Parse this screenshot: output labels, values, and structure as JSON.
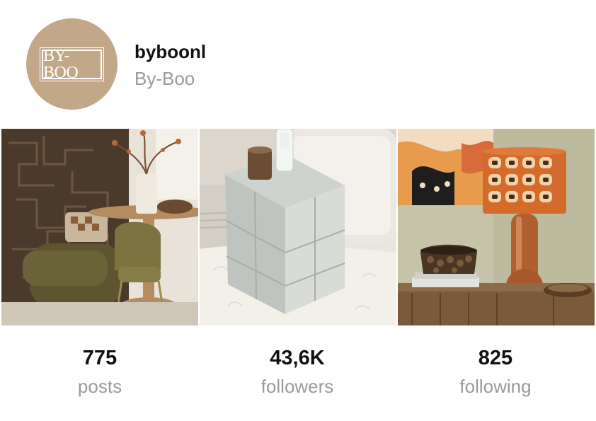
{
  "profile": {
    "username": "byboonl",
    "display_name": "By-Boo",
    "avatar_logo_text": "BY-BOO",
    "avatar_color": "#c3a789"
  },
  "posts_grid": [
    {
      "subject": "dining-nook-photo"
    },
    {
      "subject": "mirrored-side-table-photo"
    },
    {
      "subject": "retro-table-lamp-photo"
    }
  ],
  "stats": {
    "posts": {
      "count": "775",
      "label": "posts"
    },
    "followers": {
      "count": "43,6K",
      "label": "followers"
    },
    "following": {
      "count": "825",
      "label": "following"
    }
  }
}
